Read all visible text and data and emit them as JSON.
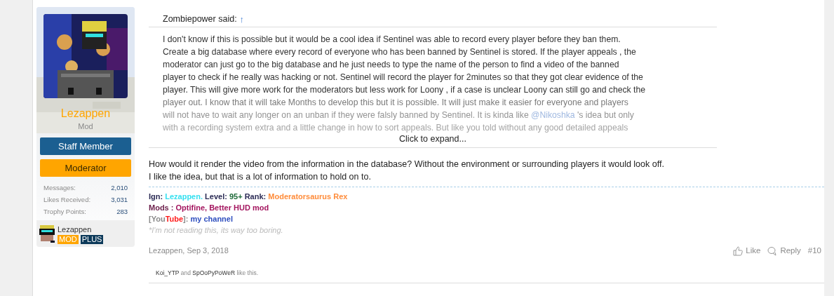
{
  "user": {
    "name": "Lezappen",
    "title": "Mod",
    "banners": [
      {
        "text": "Staff Member",
        "color": "#1b5f91"
      },
      {
        "text": "Moderator",
        "color": "#ffa500"
      }
    ],
    "stats": [
      {
        "label": "Messages:",
        "value": "2,010"
      },
      {
        "label": "Likes Received:",
        "value": "3,031"
      },
      {
        "label": "Trophy Points:",
        "value": "283"
      }
    ],
    "mini_profile": {
      "name": "Lezappen",
      "badges": [
        {
          "text": "MOD",
          "color": "#ffa500"
        },
        {
          "text": "PLUS",
          "color": "#0d3a5a"
        }
      ]
    }
  },
  "quote": {
    "author": "Zombiepower said:",
    "jump": "↑",
    "lines": [
      {
        "text": "I don't know if this is possible but it would be a cool idea if Sentinel was able to record every player before they ban them."
      },
      {
        "text": "Create a big database where every record of everyone who has been banned by Sentinel is stored. If the player appeals , the"
      },
      {
        "text": "moderator can just go to the big database and he just needs to type the name of the person to find a video of the banned"
      },
      {
        "text": "player to check if he really was hacking or not. Sentinel will record the player for 2minutes so that they got clear evidence of the"
      },
      {
        "text": "player. This will give more work for the moderators but less work for Loony , if a case is unclear Loony can still go and check the"
      },
      {
        "text": "player out. I know that it will take Months to develop this but it is possible. It will just make it easier for everyone and players"
      },
      {
        "text": "will not have to wait any longer on an unban if they were falsly banned by Sentinel. It is kinda like ",
        "mention": "@Nikoshka",
        "after": " 's idea but only"
      },
      {
        "text": "with a recording system extra and a little change in how to sort appeals. But like you told without any good detailed appeals"
      }
    ],
    "expand": "Click to expand..."
  },
  "message": [
    "How would it render the video from the information in the database? Without the environment or surrounding players it would look off.",
    "I like the idea, but that is a lot of information to hold on to."
  ],
  "signature": [
    [
      {
        "text": "Ign: ",
        "color": "#2b2b55"
      },
      {
        "text": "Lezappen.",
        "color": "#33e0f0"
      },
      {
        "text": " Level: ",
        "color": "#2b2b55"
      },
      {
        "text": "95+",
        "color": "#1f6b3a"
      },
      {
        "text": " Rank: ",
        "color": "#2b2b55"
      },
      {
        "text": "Moderatorsaurus Rex",
        "color": "#ff8c3a"
      }
    ],
    [
      {
        "text": "Mods : ",
        "color": "#6b1e4a"
      },
      {
        "text": "Optifine, Better HUD mod",
        "color": "#a3145e"
      }
    ],
    [
      {
        "text": "[You",
        "color": "#8a8a8a"
      },
      {
        "text": "Tube",
        "color": "#ff1a1a"
      },
      {
        "text": "]: ",
        "color": "#8a8a8a"
      },
      {
        "text": "my channel",
        "color": "#2f4fbf",
        "kind": "link"
      }
    ],
    [
      {
        "text": "*I'm not reading this, its way too boring.",
        "color": "#bbbbbb",
        "kind": "italic"
      }
    ]
  ],
  "footer": {
    "byline": "Lezappen, Sep 3, 2018",
    "like": "Like",
    "reply": "Reply",
    "number": "#10"
  },
  "likes": [
    {
      "text": "Koi_YTP",
      "kind": "link"
    },
    {
      "text": " and ",
      "kind": "text"
    },
    {
      "text": "SpOoPyPoWeR",
      "kind": "link"
    },
    {
      "text": " like this.",
      "kind": "text"
    }
  ]
}
